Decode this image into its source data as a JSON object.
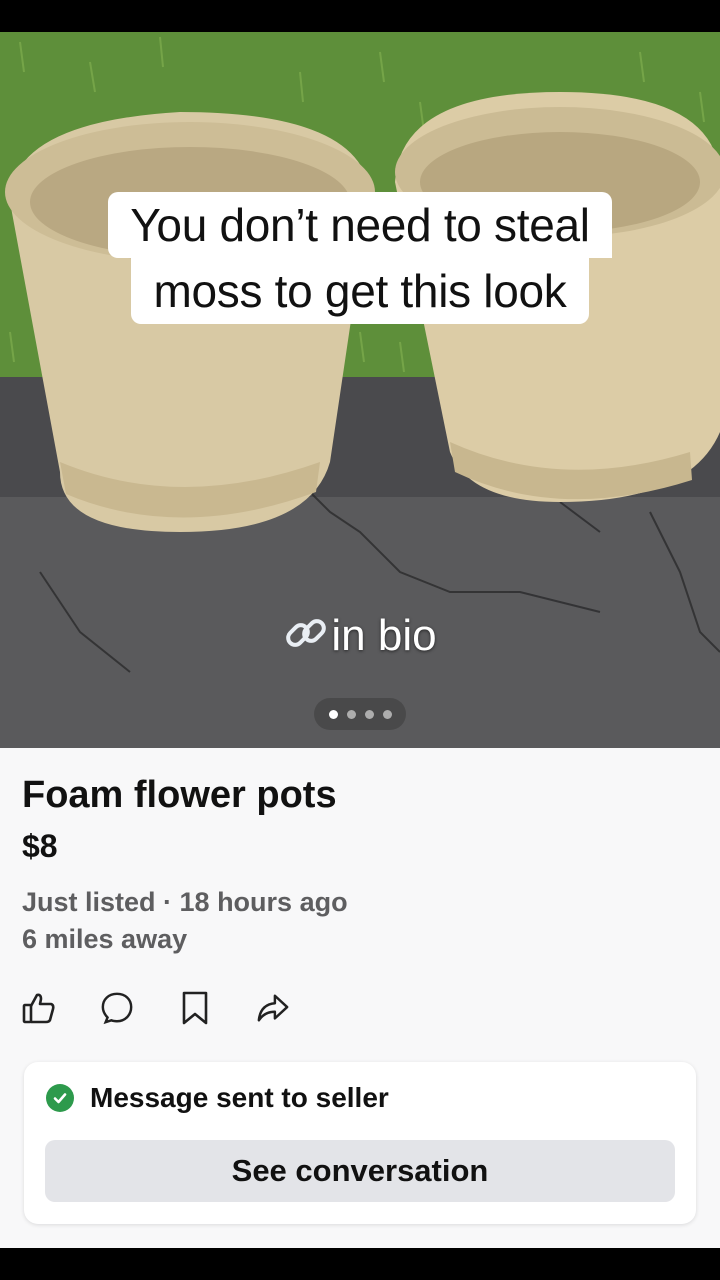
{
  "photo": {
    "caption_line_1": "You don’t need to steal",
    "caption_line_2": "moss to get this look",
    "bio_text": "in bio",
    "page_count": 4,
    "current_page": 1
  },
  "listing": {
    "title": "Foam flower pots",
    "price": "$8",
    "listed": "Just listed · 18 hours ago",
    "distance": "6 miles away"
  },
  "actions": [
    {
      "name": "like-icon"
    },
    {
      "name": "comment-icon"
    },
    {
      "name": "bookmark-icon"
    },
    {
      "name": "share-icon"
    }
  ],
  "message_card": {
    "status": "Message sent to seller",
    "button_label": "See conversation",
    "accent": "#2d9a4c"
  }
}
